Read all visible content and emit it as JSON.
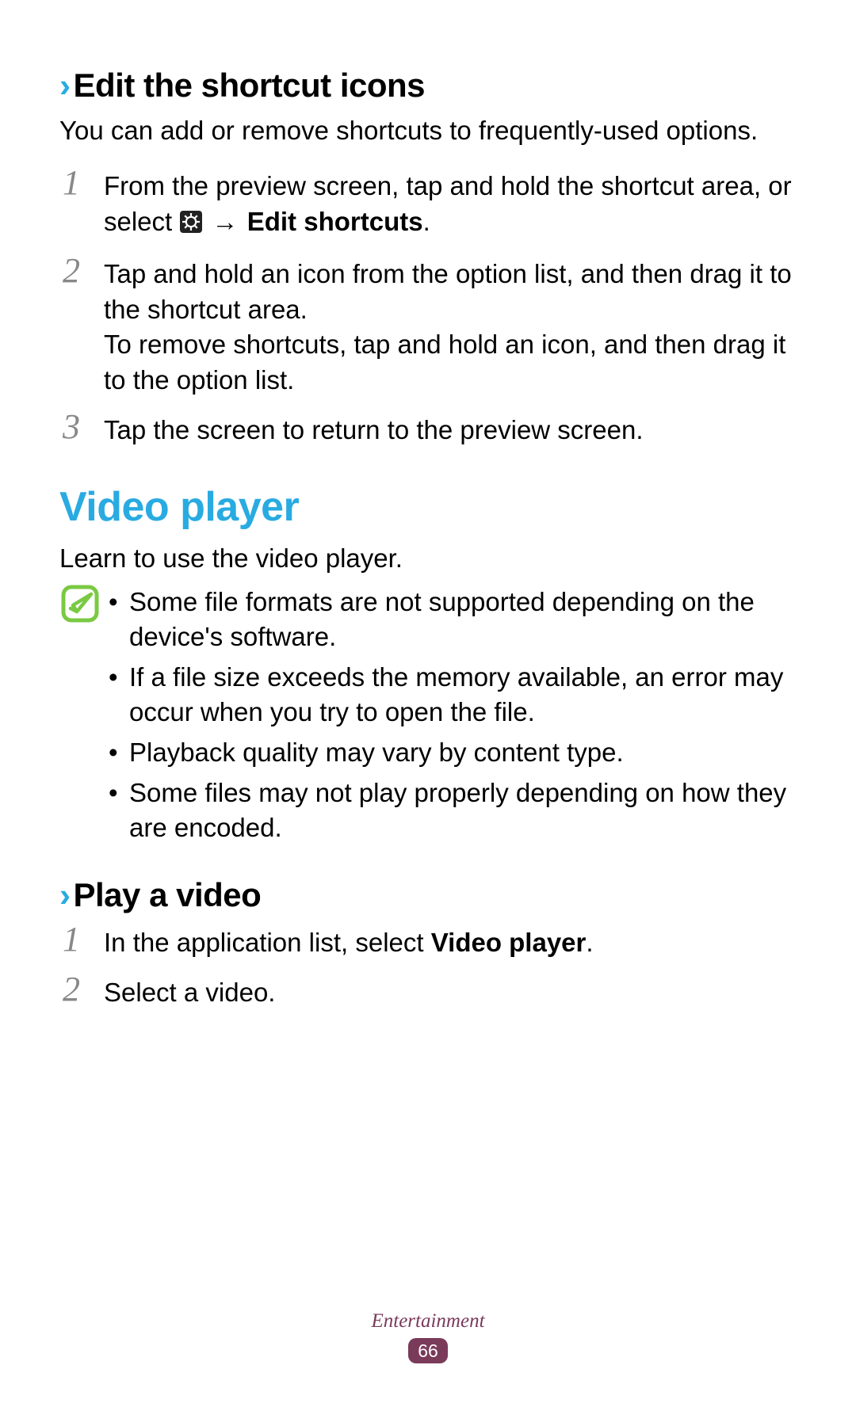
{
  "section1": {
    "heading": "Edit the shortcut icons",
    "intro": "You can add or remove shortcuts to frequently-used options.",
    "steps": [
      {
        "num": "1",
        "part_a": "From the preview screen, tap and hold the shortcut area, or select ",
        "part_b": "Edit shortcuts",
        "part_c": "."
      },
      {
        "num": "2",
        "line1": "Tap and hold an icon from the option list, and then drag it to the shortcut area.",
        "line2": "To remove shortcuts, tap and hold an icon, and then drag it to the option list."
      },
      {
        "num": "3",
        "text": "Tap the screen to return to the preview screen."
      }
    ]
  },
  "section2": {
    "heading": "Video player",
    "intro": "Learn to use the video player.",
    "notes": [
      "Some file formats are not supported depending on the device's software.",
      "If a file size exceeds the memory available, an error may occur when you try to open the file.",
      "Playback quality may vary by content type.",
      "Some files may not play properly depending on how they are encoded."
    ]
  },
  "section3": {
    "heading": "Play a video",
    "steps": [
      {
        "num": "1",
        "pre": "In the application list, select ",
        "bold": "Video player",
        "post": "."
      },
      {
        "num": "2",
        "text": "Select a video."
      }
    ]
  },
  "footer": {
    "category": "Entertainment",
    "page": "66"
  },
  "chevron": "›",
  "arrow": "→",
  "bullet": "•"
}
